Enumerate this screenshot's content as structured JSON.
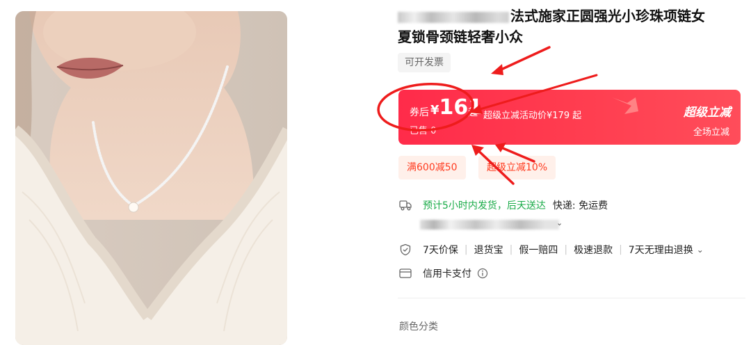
{
  "product": {
    "title_line1": "法式施家正圆强光小珍珠项链女",
    "title_line2": "夏锁骨颈链轻奢小众",
    "invoice_tag": "可开发票"
  },
  "price_card": {
    "label": "券后",
    "currency": "¥",
    "amount": "161",
    "suffix": "起",
    "activity_text": "超级立减活动价¥179 起",
    "sold_text": "已售 0",
    "badge": "超级立减",
    "scope": "全场立减"
  },
  "coupons": [
    "满600减50",
    "超级立减10%"
  ],
  "shipping": {
    "icon": "truck-icon",
    "eta": "预计5小时内发货，后天送达",
    "courier": "快递: 免运费"
  },
  "services": {
    "icon": "shield-icon",
    "items": [
      "7天价保",
      "退货宝",
      "假一赔四",
      "极速退款",
      "7天无理由退换"
    ]
  },
  "payment": {
    "icon": "card-icon",
    "label": "信用卡支付"
  },
  "sku": {
    "color_label": "颜色分类"
  },
  "colors": {
    "price_red": "#ff2b4a",
    "coupon_text": "#ff3b1f",
    "shipping_green": "#1aab48",
    "annotation_red": "#ee1c1c"
  }
}
